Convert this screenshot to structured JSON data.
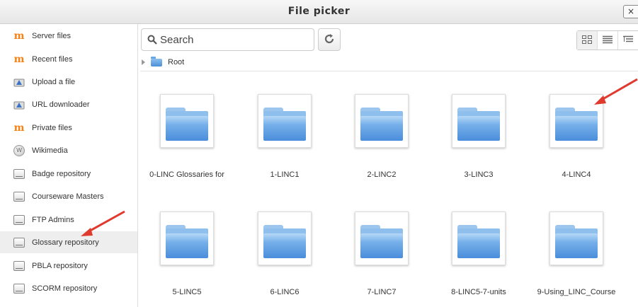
{
  "dialog": {
    "title": "File picker",
    "close_label": "×"
  },
  "sidebar": {
    "items": [
      {
        "label": "Server files",
        "icon": "moodle-icon"
      },
      {
        "label": "Recent files",
        "icon": "moodle-icon"
      },
      {
        "label": "Upload a file",
        "icon": "upload-icon"
      },
      {
        "label": "URL downloader",
        "icon": "url-icon"
      },
      {
        "label": "Private files",
        "icon": "moodle-icon"
      },
      {
        "label": "Wikimedia",
        "icon": "wikimedia-icon"
      },
      {
        "label": "Badge repository",
        "icon": "repository-icon"
      },
      {
        "label": "Courseware Masters",
        "icon": "repository-icon"
      },
      {
        "label": "FTP Admins",
        "icon": "repository-icon"
      },
      {
        "label": "Glossary repository",
        "icon": "repository-icon",
        "active": true
      },
      {
        "label": "PBLA repository",
        "icon": "repository-icon"
      },
      {
        "label": "SCORM repository",
        "icon": "repository-icon"
      }
    ]
  },
  "toolbar": {
    "search_placeholder": "Search"
  },
  "breadcrumb": {
    "root_label": "Root"
  },
  "folders": [
    "0-LINC Glossaries for",
    "1-LINC1",
    "2-LINC2",
    "3-LINC3",
    "4-LINC4",
    "5-LINC5",
    "6-LINC6",
    "7-LINC7",
    "8-LINC5-7-units",
    "9-Using_LINC_Course"
  ],
  "colors": {
    "accent": "#f98012",
    "folder": "#4a8ddb",
    "annotation_arrow": "#e03a2f"
  }
}
